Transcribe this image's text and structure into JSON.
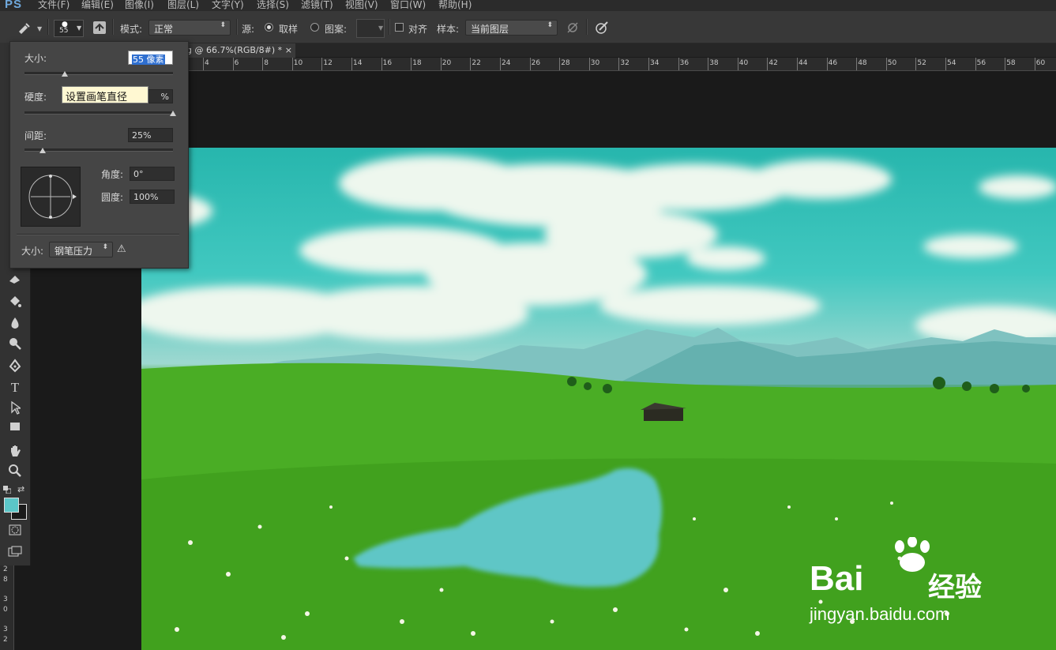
{
  "app": {
    "logo": "PS"
  },
  "menu": [
    "文件(F)",
    "编辑(E)",
    "图像(I)",
    "图层(L)",
    "文字(Y)",
    "选择(S)",
    "滤镜(T)",
    "视图(V)",
    "窗口(W)",
    "帮助(H)"
  ],
  "options_bar": {
    "brush_size": "55",
    "mode_label": "模式:",
    "mode_value": "正常",
    "source_label": "源:",
    "sampled_label": "取样",
    "pattern_label": "图案:",
    "aligned_label": "对齐",
    "sample_label": "样本:",
    "sample_value": "当前图层"
  },
  "document": {
    "tab_title": "g @ 66.7%(RGB/8#) *",
    "close_glyph": "×"
  },
  "ruler": {
    "ticks": [
      "4",
      "6",
      "8",
      "10",
      "12",
      "14",
      "16",
      "18",
      "20",
      "22",
      "24",
      "26",
      "28",
      "30",
      "32",
      "34",
      "36",
      "38",
      "40",
      "42",
      "44",
      "46",
      "48",
      "50",
      "52",
      "54",
      "56",
      "58",
      "60"
    ]
  },
  "vertical_ruler": [
    "2",
    "8",
    "3",
    "0",
    "3",
    "2"
  ],
  "brush_panel": {
    "size_label": "大小:",
    "size_value": "55 像素",
    "hardness_label": "硬度:",
    "hardness_value": "%",
    "spacing_label": "间距:",
    "spacing_value": "25%",
    "angle_label": "角度:",
    "angle_value": "0°",
    "roundness_label": "圆度:",
    "roundness_value": "100%",
    "size_control_label": "大小:",
    "size_control_value": "钢笔压力",
    "warning_glyph": "⚠"
  },
  "tooltip": "设置画笔直径",
  "watermark": {
    "brand": "Bai",
    "brand_suffix": "经验",
    "url": "jingyan.baidu.com"
  },
  "colors": {
    "foreground": "#5bc6c8",
    "background": "#1a1a1a",
    "paint_stroke": "#5ec6c6"
  }
}
